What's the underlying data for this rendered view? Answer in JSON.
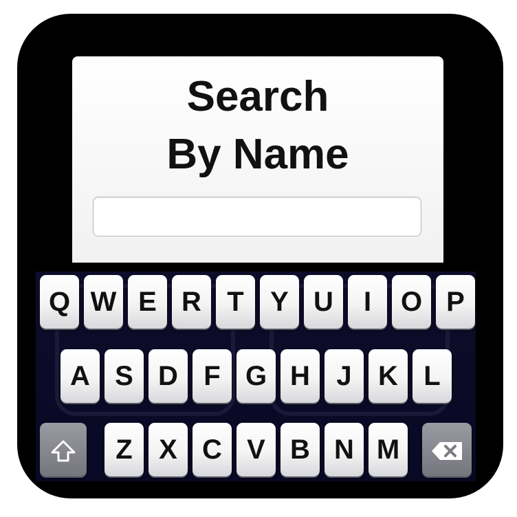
{
  "search": {
    "title_line1": "Search",
    "title_line2": "By Name",
    "input_value": "",
    "placeholder": ""
  },
  "keyboard": {
    "row1": [
      "Q",
      "W",
      "E",
      "R",
      "T",
      "Y",
      "U",
      "I",
      "O",
      "P"
    ],
    "row2": [
      "A",
      "S",
      "D",
      "F",
      "G",
      "H",
      "J",
      "K",
      "L"
    ],
    "row3": [
      "Z",
      "X",
      "C",
      "V",
      "B",
      "N",
      "M"
    ],
    "shift_icon": "shift-arrow-icon",
    "backspace_icon": "backspace-icon"
  },
  "colors": {
    "device": "#000000",
    "keyboard_bg": "#0b0b27",
    "key_light": "#f4f4f4",
    "key_dark": "#80808a"
  }
}
